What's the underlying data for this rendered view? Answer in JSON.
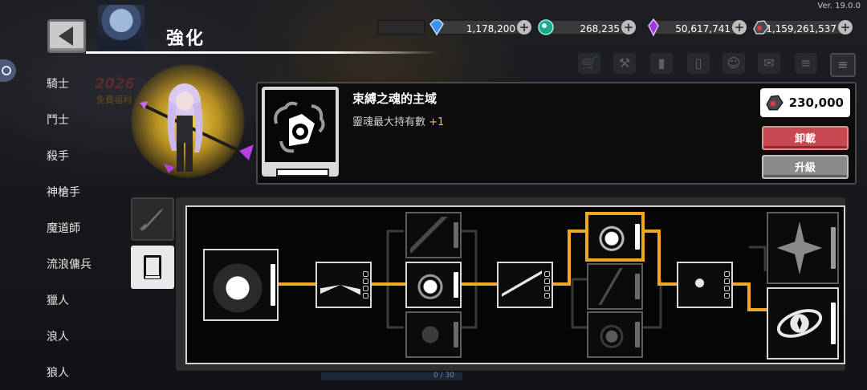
{
  "version": "Ver. 19.0.0",
  "header": {
    "title": "強化"
  },
  "currencies": [
    {
      "icon": "blue-gem-icon",
      "amount": "1,178,200"
    },
    {
      "icon": "green-orb-icon",
      "amount": "268,235"
    },
    {
      "icon": "purple-crystal-icon",
      "amount": "50,617,741"
    },
    {
      "icon": "dark-ore-icon",
      "amount": "1,159,261,537"
    }
  ],
  "classes": [
    "騎士",
    "鬥士",
    "殺手",
    "神槍手",
    "魔道師",
    "流浪傭兵",
    "獵人",
    "浪人",
    "狼人"
  ],
  "promo": {
    "year": "2026",
    "sub": "免費福利"
  },
  "skill": {
    "name": "束縛之魂的主域",
    "desc": "靈魂最大持有數",
    "bonus": "+1",
    "cost": "230,000",
    "unequip_label": "卸載",
    "upgrade_label": "升級"
  },
  "progress_text": "0 / 30",
  "colors": {
    "accent": "#f0a820",
    "unequip": "#c84850",
    "upgrade": "#8a8a8a",
    "glow": "#e6b41e"
  }
}
